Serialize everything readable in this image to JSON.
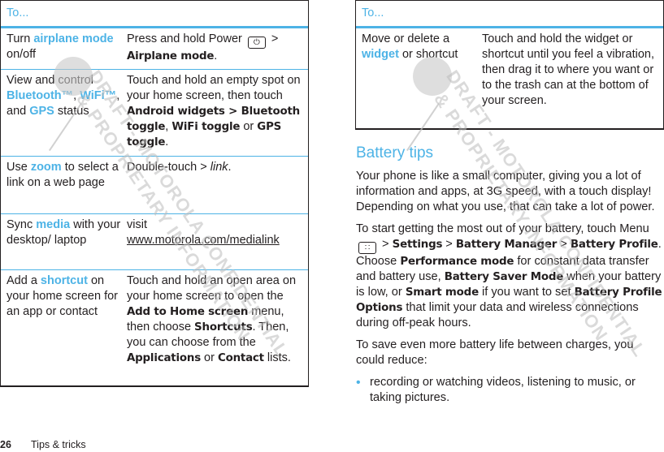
{
  "left_table": {
    "header": "To...",
    "rows": [
      {
        "task": {
          "pre": "Turn ",
          "highlight": "airplane mode",
          "post": " on/off"
        },
        "action": {
          "t1": "Press and hold Power ",
          "key_icon": "power-key-icon",
          "t2": " > ",
          "b1": "Airplane mode",
          "t3": "."
        }
      },
      {
        "task": {
          "pre": "View and control ",
          "h1": "Bluetooth™",
          "m1": ", ",
          "h2": "WiFi™",
          "m2": ", and ",
          "h3": "GPS",
          "post": " status"
        },
        "action": {
          "t1": "Touch and hold an empty spot on your home screen, then touch ",
          "b1": "Android widgets > Bluetooth toggle",
          "t2": ", ",
          "b2": "WiFi toggle",
          "t3": " or ",
          "b3": "GPS toggle",
          "t4": "."
        }
      },
      {
        "task": {
          "pre": "Use ",
          "highlight": "zoom",
          "post": " to select a link on a web page"
        },
        "action": {
          "t1": "Double-touch > ",
          "i1": "link",
          "t2": "."
        }
      },
      {
        "task": {
          "pre": "Sync ",
          "highlight": "media",
          "post": " with your desktop/ laptop"
        },
        "action": {
          "t1": "visit",
          "link": "www.motorola.com/medialink"
        }
      },
      {
        "task": {
          "pre": "Add a ",
          "highlight": "shortcut",
          "post": " on your home screen for an app or contact"
        },
        "action": {
          "t1": "Touch and hold an open area on your home screen to open the ",
          "b1": "Add to Home screen",
          "t2": " menu, then choose ",
          "b2": "Shortcuts",
          "t3": ". Then, you can choose from the ",
          "b3": "Applications",
          "t4": " or ",
          "b4": "Contact",
          "t5": " lists."
        }
      }
    ]
  },
  "right_table": {
    "header": "To...",
    "rows": [
      {
        "task": {
          "pre": "Move or delete a ",
          "highlight": "widget",
          "post": " or shortcut"
        },
        "action": {
          "t1": "Touch and hold the widget or shortcut until you feel a vibration, then drag it to where you want or to the trash can at the bottom of your screen."
        }
      }
    ]
  },
  "battery": {
    "title": "Battery tips",
    "p1": "Your phone is like a small computer, giving you a lot of information and apps, at 3G speed, with a touch display! Depending on what you use, that can take a lot of power.",
    "p2": {
      "t1": "To start getting the most out of your battery, touch Menu ",
      "key_icon": "menu-key-icon",
      "t2": " > ",
      "b1": "Settings",
      "t3": " > ",
      "b2": "Battery Manager",
      "t4": " > ",
      "b3": "Battery Profile",
      "t5": ". Choose ",
      "b4": "Performance mode",
      "t6": " for constant data transfer and battery use, ",
      "b5": "Battery Saver Mode",
      "t7": " when your battery is low, or ",
      "b6": "Smart mode",
      "t8": " if you want to set ",
      "b7": "Battery Profile Options",
      "t9": " that limit your data and wireless connections during off-peak hours."
    },
    "p3": "To save even more battery life between charges, you could reduce:",
    "bullets": [
      "recording or watching videos, listening to music, or taking pictures."
    ]
  },
  "footer": {
    "page_number": "26",
    "section": "Tips & tricks"
  },
  "watermark": {
    "line1": "DRAFT - MOTOROLA CONFIDENTIAL",
    "line2": "& PROPRIETARY INFORMATION"
  },
  "colors": {
    "accent": "#4db3e6",
    "text": "#231f20",
    "watermark": "#bdbdbd"
  }
}
